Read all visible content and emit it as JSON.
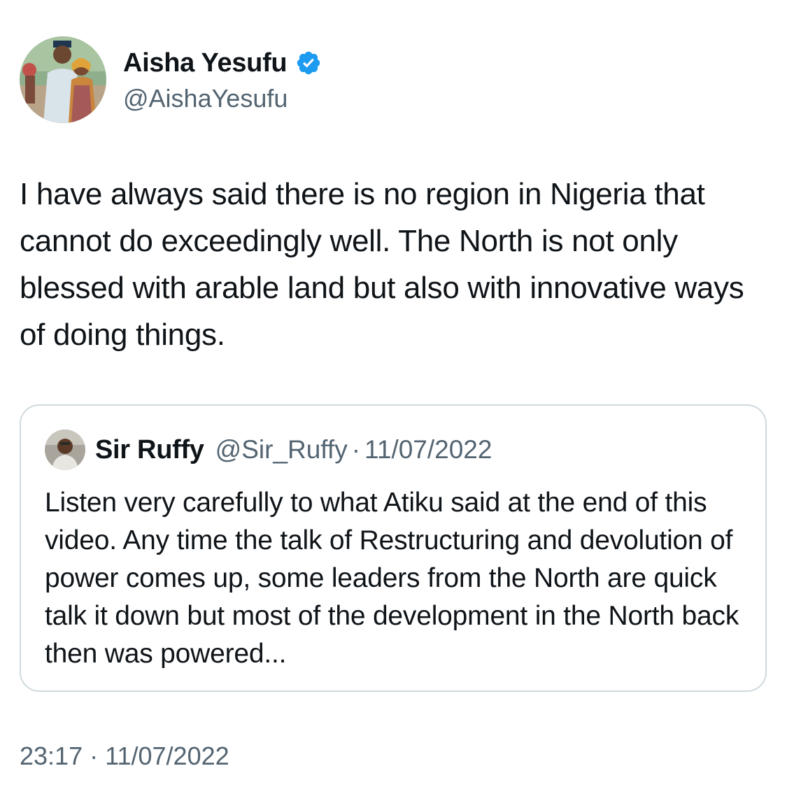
{
  "author": {
    "display_name": "Aisha Yesufu",
    "handle": "@AishaYesufu",
    "verified_icon": "verified-badge-icon"
  },
  "tweet": {
    "text": "I have always said there is no region in Nigeria that cannot do exceedingly well. The North is not only blessed with arable land but also with innovative ways of doing things."
  },
  "quoted_tweet": {
    "display_name": "Sir Ruffy",
    "handle": "@Sir_Ruffy",
    "separator": "·",
    "date": "11/07/2022",
    "text": "Listen very carefully to what Atiku said at the end of this video. Any time the talk of Restructuring and devolution of power comes up, some leaders from the North are quick talk it down but most of the development in the North back then was powered..."
  },
  "footer": {
    "time": "23:17",
    "separator": "·",
    "date": "11/07/2022"
  },
  "colors": {
    "text_primary": "#0f1419",
    "text_secondary": "#536471",
    "verified_blue": "#1d9bf0",
    "border": "#cfd9de"
  }
}
